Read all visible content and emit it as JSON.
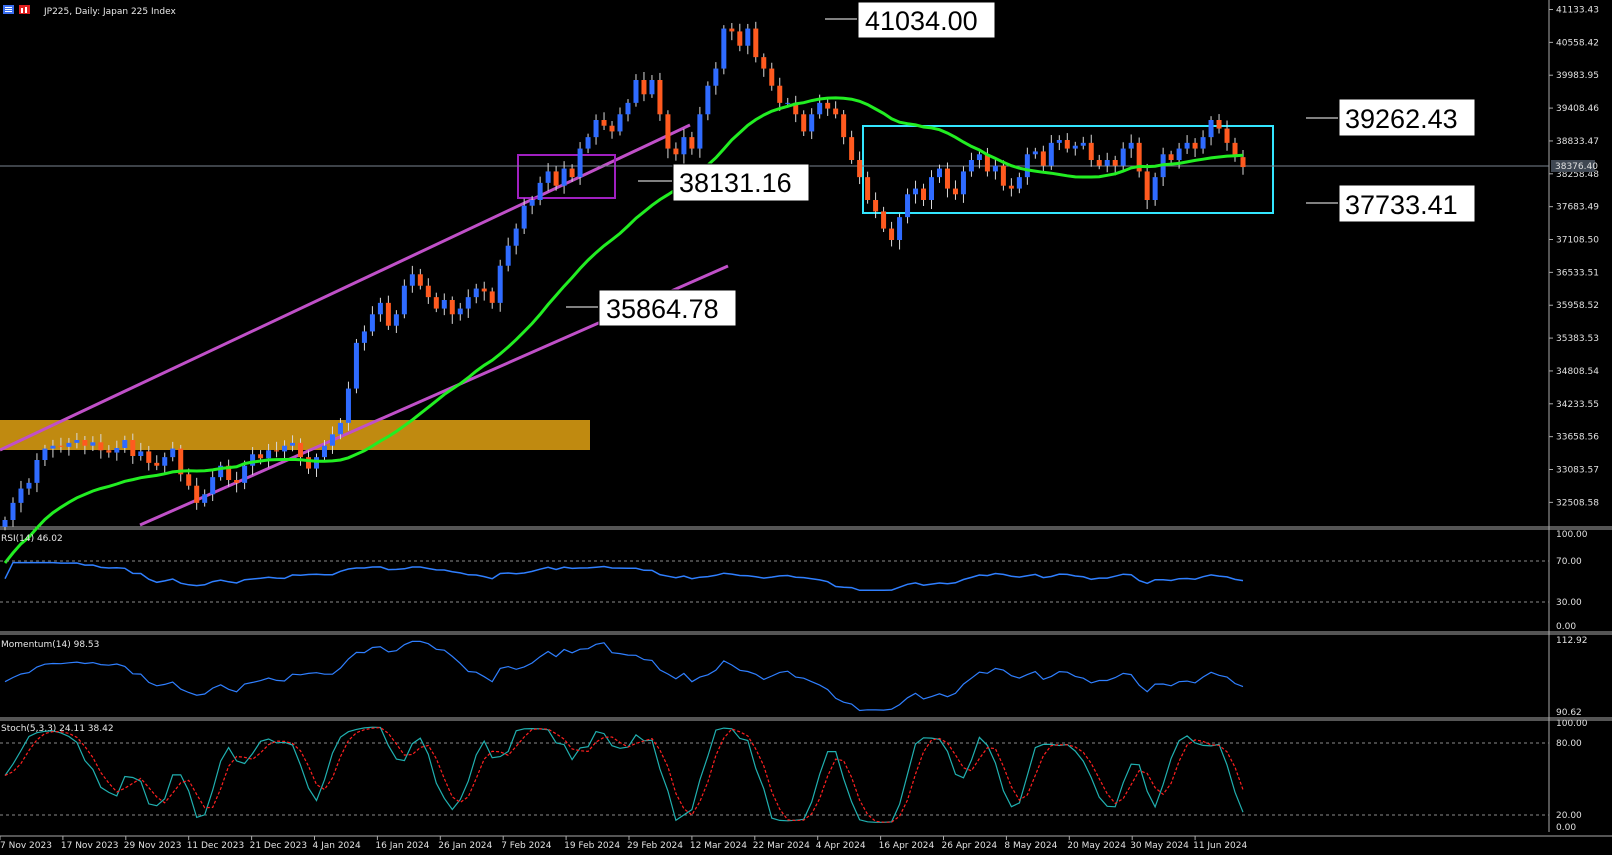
{
  "window": {
    "symbol_title": "JP225, Daily:  Japan 225 Index"
  },
  "price_axis": {
    "ticks": [
      "41133.43",
      "40558.42",
      "39983.95",
      "39408.46",
      "38833.47",
      "38258.48",
      "37683.49",
      "37108.50",
      "36533.51",
      "35958.52",
      "35383.53",
      "34808.54",
      "34233.55",
      "33658.56",
      "33083.57",
      "32508.58"
    ],
    "current_price": "38376.40"
  },
  "time_axis": {
    "labels": [
      "7 Nov 2023",
      "17 Nov 2023",
      "29 Nov 2023",
      "11 Dec 2023",
      "21 Dec 2023",
      "4 Jan 2024",
      "16 Jan 2024",
      "26 Jan 2024",
      "7 Feb 2024",
      "19 Feb 2024",
      "29 Feb 2024",
      "12 Mar 2024",
      "22 Mar 2024",
      "4 Apr 2024",
      "16 Apr 2024",
      "26 Apr 2024",
      "8 May 2024",
      "20 May 2024",
      "30 May 2024",
      "11 Jun 2024"
    ]
  },
  "annotations": {
    "high": "41034.00",
    "box_top": "39262.43",
    "box_mid": "38131.16",
    "box_bottom": "37733.41",
    "channel_low": "35864.78"
  },
  "rsi": {
    "title": "RSI(14) 46.02",
    "ticks": [
      "100.00",
      "70.00",
      "30.00",
      "0.00"
    ]
  },
  "momentum": {
    "title": "Momentum(14) 98.53",
    "ticks": [
      "112.92",
      "90.62"
    ]
  },
  "stoch": {
    "title": "Stoch(5,3,3) 24.11 38.42",
    "ticks": [
      "100.00",
      "80.00",
      "20.00",
      "0.00"
    ]
  },
  "colors": {
    "bull": "#2f6bff",
    "bear": "#ff5a1f",
    "ma": "#22ee22",
    "channel": "#c050c8",
    "zone": "#c08a10",
    "range_box": "#33e6ff",
    "pivot_box": "#a020c0",
    "indicator": "#2f7fff",
    "signal": "#ff2020",
    "stoch_main": "#20b0b0"
  },
  "chart_data": [
    {
      "type": "candlestick",
      "title": "JP225, Daily:  Japan 225 Index",
      "x_range": [
        "7 Nov 2023",
        "14 Jun 2024"
      ],
      "ylim": [
        32200,
        41300
      ],
      "close": [
        32200,
        32500,
        32750,
        32850,
        33250,
        33450,
        33500,
        33480,
        33550,
        33600,
        33500,
        33560,
        33420,
        33380,
        33460,
        33600,
        33320,
        33400,
        33200,
        33150,
        33300,
        33450,
        33000,
        32800,
        32500,
        32650,
        32950,
        33150,
        32900,
        32850,
        33150,
        33350,
        33280,
        33420,
        33400,
        33500,
        33550,
        33300,
        33100,
        33300,
        33500,
        33700,
        33900,
        34500,
        35300,
        35500,
        35800,
        36000,
        35600,
        35800,
        36300,
        36500,
        36300,
        36100,
        35900,
        36050,
        35800,
        35900,
        36100,
        36250,
        36200,
        36000,
        36650,
        37000,
        37300,
        37700,
        37800,
        38100,
        38300,
        38050,
        38350,
        38200,
        38700,
        38900,
        39200,
        39100,
        39000,
        39300,
        39500,
        39900,
        39650,
        39900,
        39300,
        38700,
        38600,
        38900,
        38700,
        39300,
        39800,
        40100,
        40800,
        40750,
        40500,
        40800,
        40300,
        40100,
        39800,
        39500,
        39500,
        39300,
        39000,
        39300,
        39500,
        39400,
        39300,
        38900,
        38500,
        38200,
        37800,
        37600,
        37300,
        37100,
        37500,
        37900,
        38000,
        37800,
        38200,
        38350,
        38000,
        37900,
        38300,
        38500,
        38600,
        38300,
        38400,
        38050,
        38000,
        38200,
        38600,
        38650,
        38400,
        38800,
        38850,
        38700,
        38750,
        38800,
        38500,
        38400,
        38500,
        38400,
        38700,
        38800,
        38300,
        37800,
        38200,
        38600,
        38500,
        38700,
        38800,
        38700,
        38900,
        39200,
        39050,
        38800,
        38550,
        38376.4
      ],
      "ma_series_name": "",
      "indicator_rows": [
        "RSI(14) 46.02",
        "Momentum(14) 98.53",
        "Stoch(5,3,3) 24.11 38.42"
      ]
    }
  ]
}
